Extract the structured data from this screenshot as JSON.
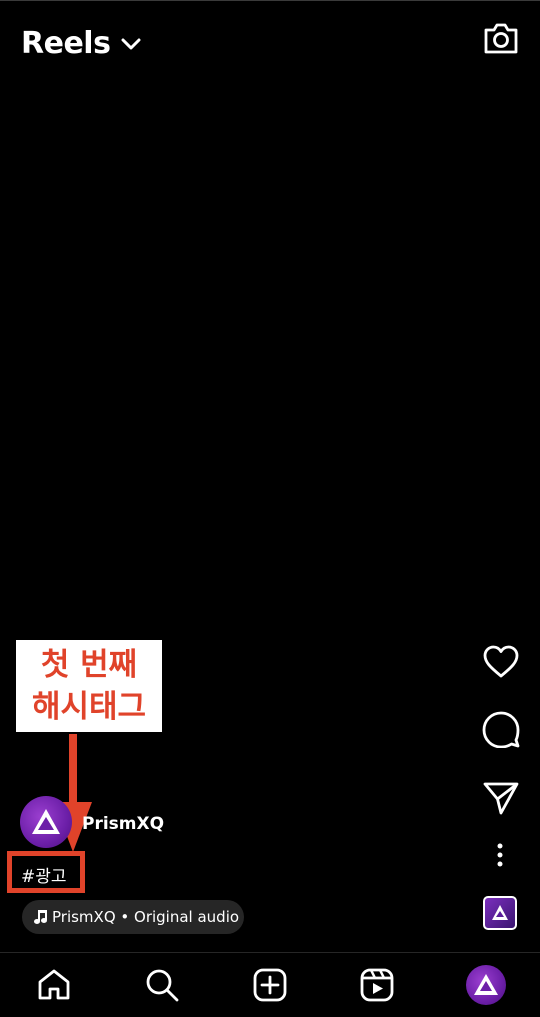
{
  "header": {
    "title": "Reels",
    "title_menu_icon": "chevron-down-icon",
    "camera_icon": "camera-icon"
  },
  "annotation": {
    "lines": [
      "첫 번째",
      "해시태그"
    ],
    "color": "#e0432a"
  },
  "post": {
    "author": "PrismXQ",
    "hashtag": "#광고",
    "audio": "PrismXQ • Original audio"
  },
  "side_actions": [
    "heart-icon",
    "comment-icon",
    "share-icon",
    "more-icon",
    "audio-thumbnail"
  ],
  "bottom_nav": [
    "home-icon",
    "search-icon",
    "create-icon",
    "reels-icon",
    "profile-avatar"
  ],
  "colors": {
    "background": "#000000",
    "accent_avatar": "#6c1fa8",
    "pill": "#262626"
  }
}
